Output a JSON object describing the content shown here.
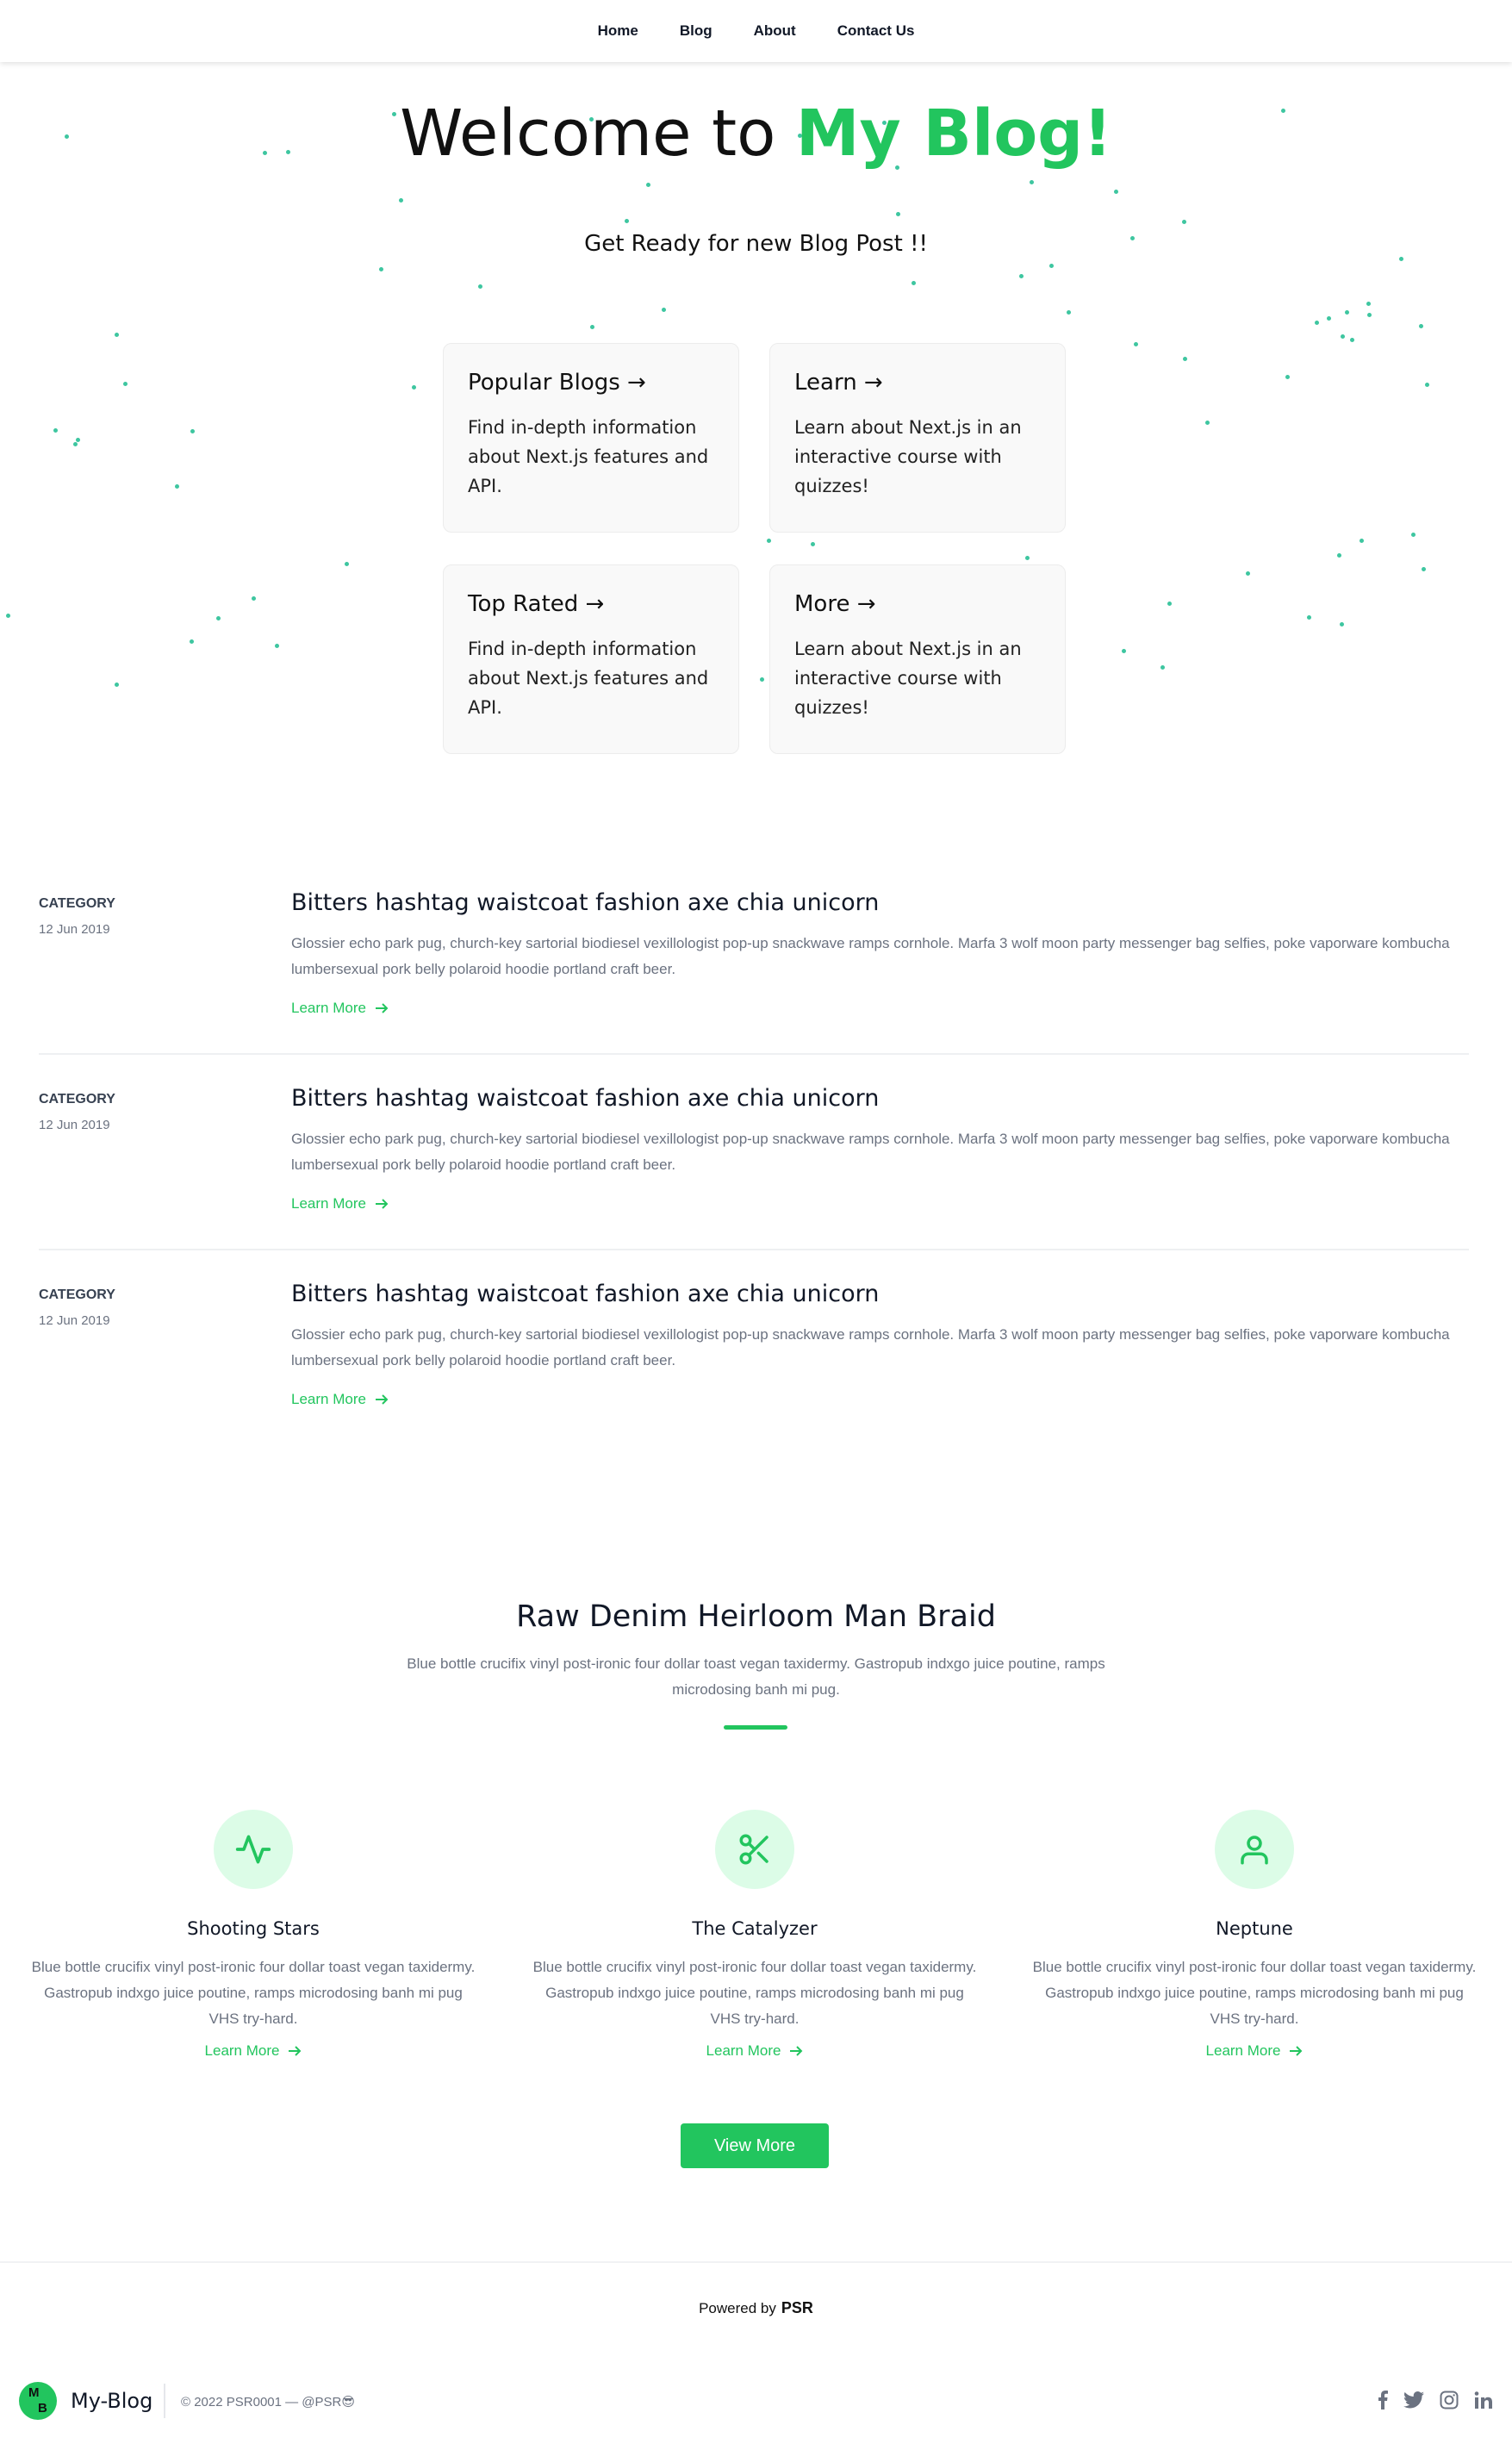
{
  "nav": {
    "items": [
      "Home",
      "Blog",
      "About",
      "Contact Us"
    ]
  },
  "hero": {
    "title_prefix": "Welcome to ",
    "title_accent": "My Blog!",
    "subtitle": "Get Ready for new Blog Post !!",
    "cards": [
      {
        "title": "Popular Blogs →",
        "text": "Find in-depth information about Next.js features and API."
      },
      {
        "title": "Learn →",
        "text": "Learn about Next.js in an interactive course with quizzes!"
      },
      {
        "title": "Top Rated →",
        "text": "Find in-depth information about Next.js features and API."
      },
      {
        "title": "More →",
        "text": "Learn about Next.js in an interactive course with quizzes!"
      }
    ]
  },
  "posts": [
    {
      "category": "CATEGORY",
      "date": "12 Jun 2019",
      "title": "Bitters hashtag waistcoat fashion axe chia unicorn",
      "description": "Glossier echo park pug, church-key sartorial biodiesel vexillologist pop-up snackwave ramps cornhole. Marfa 3 wolf moon party messenger bag selfies, poke vaporware kombucha lumbersexual pork belly polaroid hoodie portland craft beer.",
      "link": "Learn More"
    },
    {
      "category": "CATEGORY",
      "date": "12 Jun 2019",
      "title": "Bitters hashtag waistcoat fashion axe chia unicorn",
      "description": "Glossier echo park pug, church-key sartorial biodiesel vexillologist pop-up snackwave ramps cornhole. Marfa 3 wolf moon party messenger bag selfies, poke vaporware kombucha lumbersexual pork belly polaroid hoodie portland craft beer.",
      "link": "Learn More"
    },
    {
      "category": "CATEGORY",
      "date": "12 Jun 2019",
      "title": "Bitters hashtag waistcoat fashion axe chia unicorn",
      "description": "Glossier echo park pug, church-key sartorial biodiesel vexillologist pop-up snackwave ramps cornhole. Marfa 3 wolf moon party messenger bag selfies, poke vaporware kombucha lumbersexual pork belly polaroid hoodie portland craft beer.",
      "link": "Learn More"
    }
  ],
  "features": {
    "title": "Raw Denim Heirloom Man Braid",
    "subtitle": "Blue bottle crucifix vinyl post-ironic four dollar toast vegan taxidermy. Gastropub indxgo juice poutine, ramps microdosing banh mi pug.",
    "items": [
      {
        "icon": "activity-icon",
        "title": "Shooting Stars",
        "text": "Blue bottle crucifix vinyl post-ironic four dollar toast vegan taxidermy. Gastropub indxgo juice poutine, ramps microdosing banh mi pug VHS try-hard.",
        "link": "Learn More"
      },
      {
        "icon": "scissors-icon",
        "title": "The Catalyzer",
        "text": "Blue bottle crucifix vinyl post-ironic four dollar toast vegan taxidermy. Gastropub indxgo juice poutine, ramps microdosing banh mi pug VHS try-hard.",
        "link": "Learn More"
      },
      {
        "icon": "user-icon",
        "title": "Neptune",
        "text": "Blue bottle crucifix vinyl post-ironic four dollar toast vegan taxidermy. Gastropub indxgo juice poutine, ramps microdosing banh mi pug VHS try-hard.",
        "link": "Learn More"
      }
    ],
    "button": "View More"
  },
  "footer": {
    "powered_prefix": "Powered by",
    "powered_brand": "PSR",
    "logo_letters": [
      "M",
      "B"
    ],
    "brand": "My-Blog",
    "copyright": "© 2022 PSR0001 — @PSR😎",
    "social_icons": [
      "facebook-icon",
      "twitter-icon",
      "instagram-icon",
      "linkedin-icon"
    ]
  },
  "colors": {
    "accent": "#22c55e",
    "accent_light": "#dcfce7",
    "dots": "#3ec6a0"
  }
}
